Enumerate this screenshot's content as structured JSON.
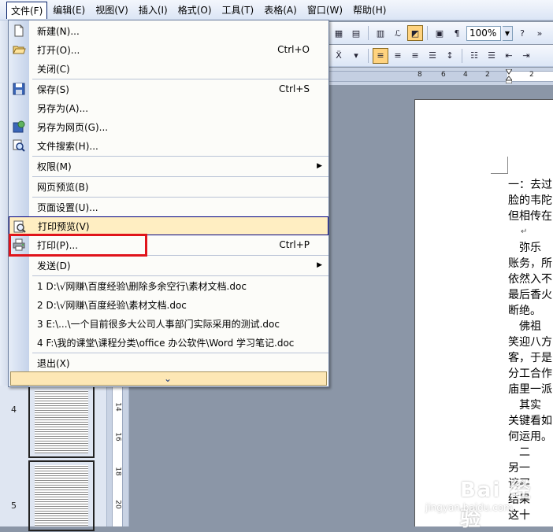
{
  "menubar": {
    "items": [
      "文件(F)",
      "编辑(E)",
      "视图(V)",
      "插入(I)",
      "格式(O)",
      "工具(T)",
      "表格(A)",
      "窗口(W)",
      "帮助(H)"
    ]
  },
  "toolbar": {
    "zoom": "100%"
  },
  "ruler": {
    "numbers": [
      "8",
      "6",
      "4",
      "2",
      "2"
    ]
  },
  "file_menu": {
    "items": [
      {
        "label": "新建(N)...",
        "shortcut": "",
        "icon": "new-document-icon"
      },
      {
        "label": "打开(O)...",
        "shortcut": "Ctrl+O",
        "icon": "open-folder-icon"
      },
      {
        "label": "关闭(C)",
        "shortcut": "",
        "icon": ""
      },
      {
        "label": "保存(S)",
        "shortcut": "Ctrl+S",
        "icon": "save-icon"
      },
      {
        "label": "另存为(A)...",
        "shortcut": "",
        "icon": ""
      },
      {
        "label": "另存为网页(G)...",
        "shortcut": "",
        "icon": "save-web-icon"
      },
      {
        "label": "文件搜索(H)...",
        "shortcut": "",
        "icon": "file-search-icon"
      },
      {
        "label": "权限(M)",
        "shortcut": "",
        "icon": "",
        "submenu": true
      },
      {
        "label": "网页预览(B)",
        "shortcut": "",
        "icon": ""
      },
      {
        "label": "页面设置(U)...",
        "shortcut": "",
        "icon": ""
      },
      {
        "label": "打印预览(V)",
        "shortcut": "",
        "icon": "print-preview-icon"
      },
      {
        "label": "打印(P)...",
        "shortcut": "Ctrl+P",
        "icon": "printer-icon"
      },
      {
        "label": "发送(D)",
        "shortcut": "",
        "icon": "",
        "submenu": true
      },
      {
        "label": "1 D:\\√网赚\\百度经验\\删除多余空行\\素材文档.doc",
        "shortcut": "",
        "icon": ""
      },
      {
        "label": "2 D:\\√网赚\\百度经验\\素材文档.doc",
        "shortcut": "",
        "icon": ""
      },
      {
        "label": "3 E:\\...\\一个目前很多大公司人事部门实际采用的测试.doc",
        "shortcut": "",
        "icon": ""
      },
      {
        "label": "4 F:\\我的课堂\\课程分类\\office 办公软件\\Word 学习笔记.doc",
        "shortcut": "",
        "icon": ""
      },
      {
        "label": "退出(X)",
        "shortcut": "",
        "icon": ""
      }
    ]
  },
  "thumbnails": {
    "pages": [
      "4",
      "5"
    ]
  },
  "vruler": {
    "numbers": [
      "14",
      "16",
      "18",
      "20"
    ]
  },
  "document": {
    "lines": [
      "一：去过",
      "脸的韦陀",
      "但相传在",
      "↵",
      "　弥乐",
      "账务，所",
      "依然入不",
      "最后香火",
      "断绝。",
      "　佛祖",
      "笑迎八方",
      "客，于是",
      "分工合作",
      "庙里一派",
      "　其实",
      "关键看如",
      "何运用。",
      "　二",
      "另一",
      "该买",
      "结果",
      "这十"
    ]
  },
  "watermark": {
    "main": "Bai 经验",
    "sub": "jingyan.baidu.com"
  },
  "colors": {
    "highlight": "#ffeec2",
    "annotation_box": "#e0141b",
    "menu_gutter": "#c5d3ea"
  }
}
